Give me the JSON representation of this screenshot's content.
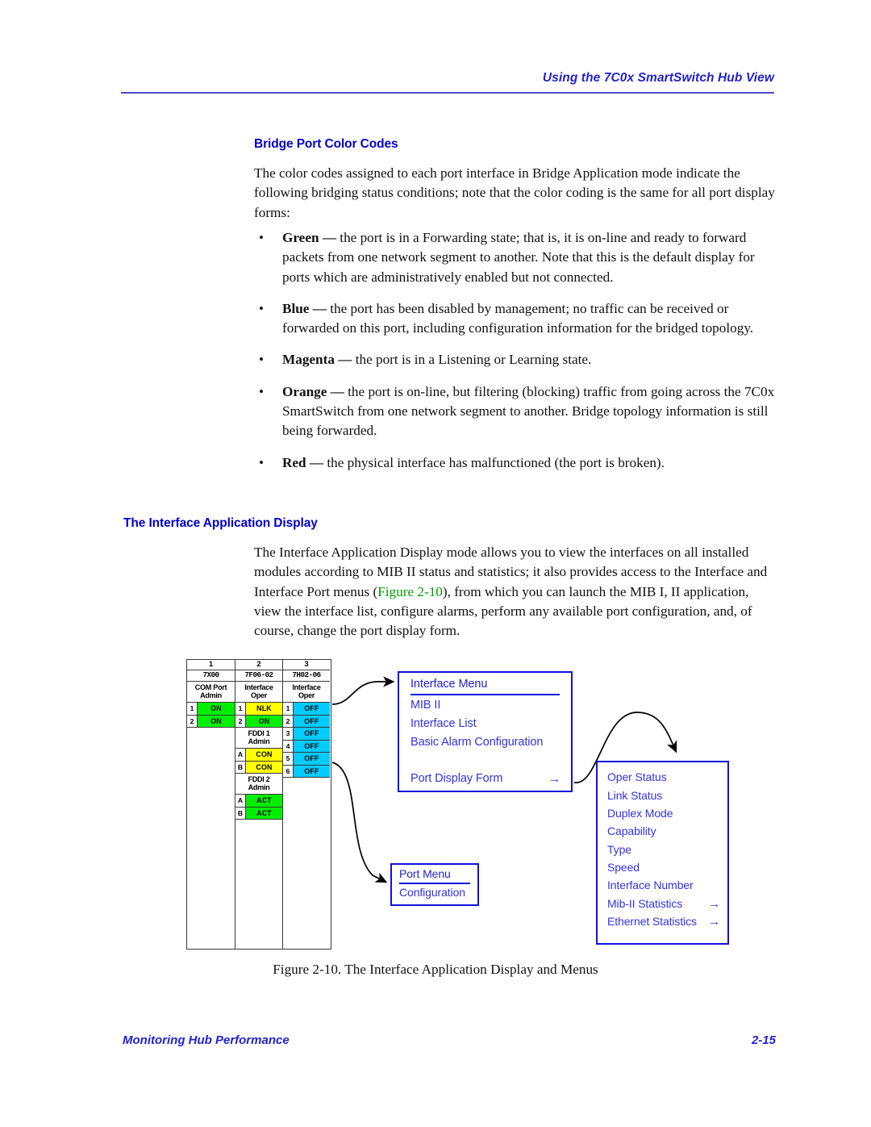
{
  "header": {
    "title": "Using the 7C0x SmartSwitch Hub View"
  },
  "sections": {
    "bridge_port_color_codes": {
      "heading": "Bridge Port Color Codes",
      "intro": "The color codes assigned to each port interface in Bridge Application mode indicate the following bridging status conditions; note that the color coding is the same for all port display forms:",
      "bullets": [
        {
          "term": "Green",
          "dash": " — ",
          "text": "the port is in a Forwarding state; that is, it is on-line and ready to forward packets from one network segment to another. Note that this is the default display for ports which are administratively enabled but not connected.",
          "color": "#00a000"
        },
        {
          "term": "Blue",
          "dash": " — ",
          "text": "the port has been disabled by management; no traffic can be received or forwarded on this port, including configuration information for the bridged topology.",
          "color": "#0000cc"
        },
        {
          "term": "Magenta",
          "dash": " — ",
          "text": "the port is in a Listening or Learning state.",
          "color": "#cc00cc"
        },
        {
          "term": "Orange",
          "dash": " — ",
          "text": "the port is on-line, but filtering (blocking) traffic from going across the 7C0x SmartSwitch from one network segment to another. Bridge topology information is still being forwarded.",
          "color": "#ff8800"
        },
        {
          "term": "Red",
          "dash": " — ",
          "text": "the physical interface has malfunctioned (the port is broken).",
          "color": "#cc0000"
        }
      ]
    },
    "interface_application_display": {
      "heading": "The Interface Application Display",
      "para_part1": "The Interface Application Display mode allows you to view the interfaces on all installed modules according to MIB II status and statistics; it also provides access to the Interface and Interface Port menus (",
      "link_text": "Figure 2-10",
      "para_part2": "), from which you can launch the MIB I, II application, view the interface list, configure alarms, perform any available port configuration, and, of course, change the port display form."
    }
  },
  "figure": {
    "caption": "Figure 2-10.  The Interface Application Display and Menus",
    "device_panel": {
      "columns": [
        {
          "slot": "1",
          "module": "7X00",
          "group_header_line1": "COM Port",
          "group_header_line2": "Admin",
          "ports": [
            {
              "num": "1",
              "value": "ON",
              "color": "#00ef00"
            },
            {
              "num": "2",
              "value": "ON",
              "color": "#00ef00"
            }
          ],
          "groups": []
        },
        {
          "slot": "2",
          "module": "7F06-02",
          "group_header_line1": "Interface",
          "group_header_line2": "Oper",
          "ports": [
            {
              "num": "1",
              "value": "NLK",
              "color": "#ffff00"
            },
            {
              "num": "2",
              "value": "ON",
              "color": "#00ef00"
            }
          ],
          "groups": [
            {
              "header_line1": "FDDI 1",
              "header_line2": "Admin",
              "ports": [
                {
                  "num": "A",
                  "value": "CON",
                  "color": "#ffff00"
                },
                {
                  "num": "B",
                  "value": "CON",
                  "color": "#ffff00"
                }
              ]
            },
            {
              "header_line1": "FDDI 2",
              "header_line2": "Admin",
              "ports": [
                {
                  "num": "A",
                  "value": "ACT",
                  "color": "#00ef00"
                },
                {
                  "num": "B",
                  "value": "ACT",
                  "color": "#00ef00"
                }
              ]
            }
          ]
        },
        {
          "slot": "3",
          "module": "7H02-06",
          "group_header_line1": "Interface",
          "group_header_line2": "Oper",
          "ports": [
            {
              "num": "1",
              "value": "OFF",
              "color": "#00ccff"
            },
            {
              "num": "2",
              "value": "OFF",
              "color": "#00ccff"
            },
            {
              "num": "3",
              "value": "OFF",
              "color": "#00ccff"
            },
            {
              "num": "4",
              "value": "OFF",
              "color": "#00ccff"
            },
            {
              "num": "5",
              "value": "OFF",
              "color": "#00ccff"
            },
            {
              "num": "6",
              "value": "OFF",
              "color": "#00ccff"
            }
          ],
          "groups": []
        }
      ]
    },
    "interface_menu": {
      "title": "Interface Menu",
      "items": [
        {
          "label": "MIB II",
          "submenu_arrow": ""
        },
        {
          "label": "Interface List",
          "submenu_arrow": ""
        },
        {
          "label": "Basic Alarm Configuration",
          "submenu_arrow": ""
        }
      ],
      "bottom_item": {
        "label": "Port Display Form",
        "submenu_arrow": "→"
      }
    },
    "port_menu": {
      "title": "Port Menu",
      "items": [
        {
          "label": "Configuration",
          "submenu_arrow": ""
        }
      ]
    },
    "port_display_submenu": {
      "items": [
        {
          "label": "Oper Status",
          "submenu_arrow": ""
        },
        {
          "label": "Link Status",
          "submenu_arrow": ""
        },
        {
          "label": "Duplex Mode",
          "submenu_arrow": ""
        },
        {
          "label": "Capability",
          "submenu_arrow": ""
        },
        {
          "label": "Type",
          "submenu_arrow": ""
        },
        {
          "label": "Speed",
          "submenu_arrow": ""
        },
        {
          "label": "Interface Number",
          "submenu_arrow": ""
        },
        {
          "label": "Mib-II Statistics",
          "submenu_arrow": "→"
        },
        {
          "label": "Ethernet Statistics",
          "submenu_arrow": "→"
        }
      ]
    }
  },
  "footer": {
    "left": "Monitoring Hub Performance",
    "page_number": "2-15"
  },
  "colors": {
    "heading_blue": "#0000cc",
    "header_blue": "#2222cc",
    "link_green": "#00a000",
    "status_on": "#00ef00",
    "status_nlk": "#ffff00",
    "status_off": "#00ccff"
  }
}
